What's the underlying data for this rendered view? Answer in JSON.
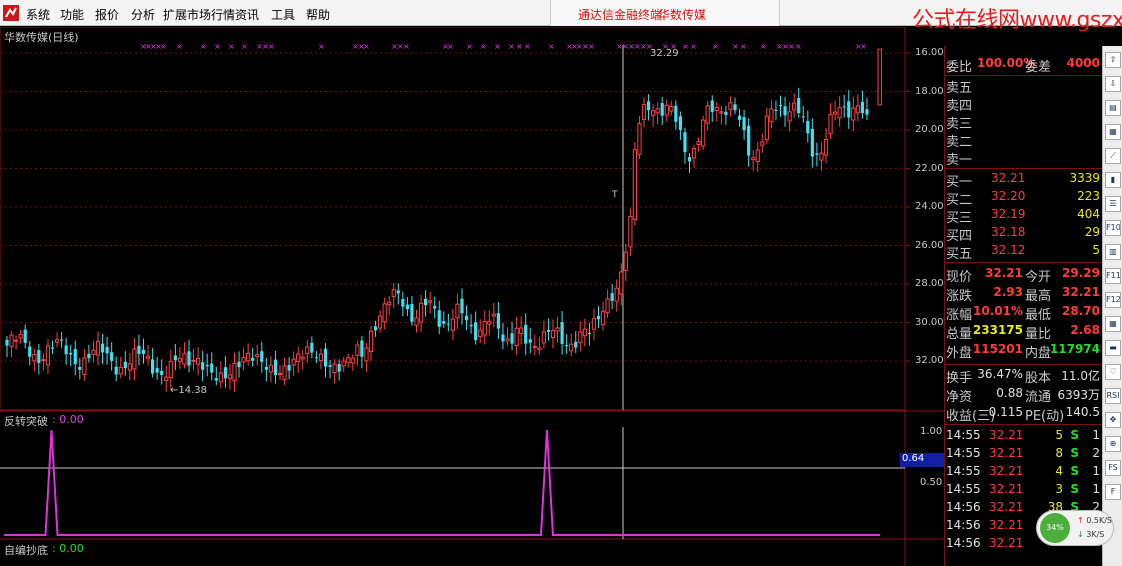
{
  "menu": {
    "items": [
      "系统",
      "功能",
      "报价",
      "分析",
      "扩展市场行情",
      "资讯",
      "工具",
      "帮助"
    ],
    "center_left": "通达信金融终端",
    "center_right": "华数传媒"
  },
  "watermark": "公式在线网www.gszx.com.cn",
  "main_chart": {
    "title": "华数传媒(日线)",
    "y_ticks": [
      "32.00",
      "30.00",
      "28.00",
      "26.00",
      "24.00",
      "22.00",
      "20.00",
      "18.00",
      "16.00"
    ],
    "high_label": "32.29",
    "low_label": "←14.38",
    "cursor_marker": "T"
  },
  "indicator1": {
    "title": "反转突破",
    "value": ": 0.00",
    "y_ticks": [
      "1.00",
      "0.50"
    ],
    "cursor_value": "0.64"
  },
  "indicator2": {
    "title": "自编抄底",
    "value": ": 0.00"
  },
  "chart_data": {
    "type": "candlestick",
    "title": "华数传媒(日线)",
    "ylim": [
      14.0,
      33.0
    ],
    "y_ticks": [
      16,
      18,
      20,
      22,
      24,
      26,
      28,
      30,
      32
    ],
    "high_marker": 32.29,
    "low_marker": 14.38,
    "indicator_peaks": [
      {
        "name": "反转突破",
        "ylim": [
          0,
          1
        ],
        "y_ticks": [
          0.5,
          1.0
        ],
        "peaks_at_fraction": [
          0.054,
          0.617
        ],
        "peak_value": 1.0,
        "baseline": 0.0
      }
    ]
  },
  "quote": {
    "weibi": {
      "label": "委比",
      "value": "100.00%",
      "label2": "委差",
      "value2": "4000"
    },
    "sell": [
      {
        "label": "卖五"
      },
      {
        "label": "卖四"
      },
      {
        "label": "卖三"
      },
      {
        "label": "卖二"
      },
      {
        "label": "卖一"
      }
    ],
    "buy": [
      {
        "label": "买一",
        "price": "32.21",
        "vol": "3339"
      },
      {
        "label": "买二",
        "price": "32.20",
        "vol": "223"
      },
      {
        "label": "买三",
        "price": "32.19",
        "vol": "404"
      },
      {
        "label": "买四",
        "price": "32.18",
        "vol": "29"
      },
      {
        "label": "买五",
        "price": "32.12",
        "vol": "5"
      }
    ],
    "stats": [
      {
        "l1": "现价",
        "v1": "32.21",
        "l2": "今开",
        "v2": "29.29",
        "c1": "#ff3b3b",
        "c2": "#ff3b3b"
      },
      {
        "l1": "涨跌",
        "v1": "2.93",
        "l2": "最高",
        "v2": "32.21",
        "c1": "#ff3b3b",
        "c2": "#ff3b3b"
      },
      {
        "l1": "涨幅",
        "v1": "10.01%",
        "l2": "最低",
        "v2": "28.70",
        "c1": "#ff3b3b",
        "c2": "#ff3b3b"
      },
      {
        "l1": "总量",
        "v1": "233175",
        "l2": "量比",
        "v2": "2.68",
        "c1": "#e8e820",
        "c2": "#ff3b3b"
      },
      {
        "l1": "外盘",
        "v1": "115201",
        "l2": "内盘",
        "v2": "117974",
        "c1": "#ff3b3b",
        "c2": "#20e020"
      }
    ],
    "info": [
      {
        "l1": "换手",
        "v1": "36.47%",
        "l2": "股本",
        "v2": "11.0亿"
      },
      {
        "l1": "净资",
        "v1": "0.88",
        "l2": "流通",
        "v2": "6393万"
      },
      {
        "l1": "收益(三)",
        "v1": "0.115",
        "l2": "PE(动)",
        "v2": "140.5"
      }
    ],
    "ticks": [
      {
        "time": "14:55",
        "price": "32.21",
        "vol": "5",
        "dir": "S",
        "n": "1"
      },
      {
        "time": "14:55",
        "price": "32.21",
        "vol": "8",
        "dir": "S",
        "n": "2"
      },
      {
        "time": "14:55",
        "price": "32.21",
        "vol": "4",
        "dir": "S",
        "n": "1"
      },
      {
        "time": "14:55",
        "price": "32.21",
        "vol": "3",
        "dir": "S",
        "n": "1"
      },
      {
        "time": "14:56",
        "price": "32.21",
        "vol": "38",
        "dir": "S",
        "n": "2"
      },
      {
        "time": "14:56",
        "price": "32.21",
        "vol": "",
        "dir": "",
        "n": ""
      },
      {
        "time": "14:56",
        "price": "32.21",
        "vol": "",
        "dir": "",
        "n": ""
      }
    ]
  },
  "speed": {
    "percent": "34%",
    "up": "0.5K/S",
    "down": "3K/S"
  },
  "toolbar_icons": [
    "arrow-up-icon",
    "arrow-down-icon",
    "book-icon",
    "grid-icon",
    "line-chart-icon",
    "candle-icon",
    "list-icon",
    "f10-icon",
    "doc-icon",
    "f11-icon",
    "f12-icon",
    "table-icon",
    "bars-icon",
    "heart-icon",
    "rsi-icon",
    "move-icon",
    "compass-icon",
    "fs-icon",
    "f-icon"
  ]
}
